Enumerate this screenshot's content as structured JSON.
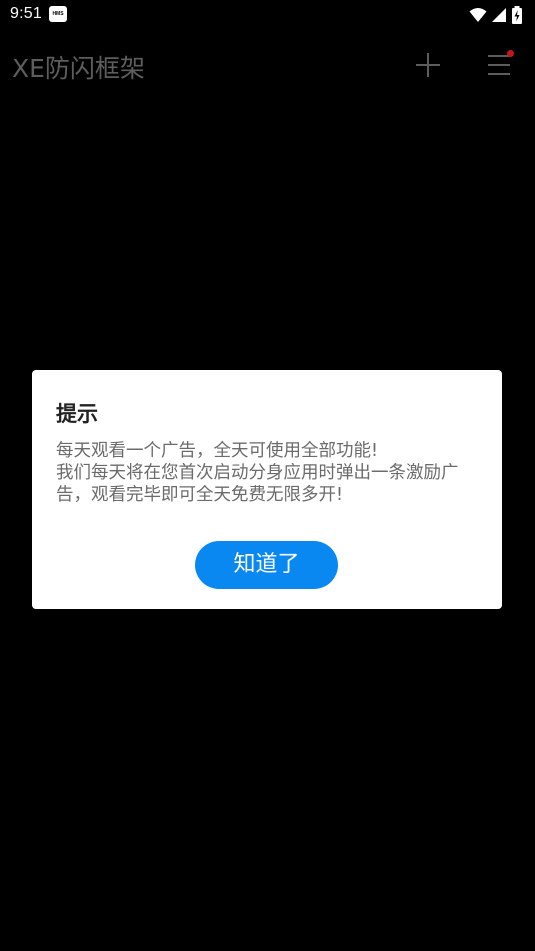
{
  "status_bar": {
    "time": "9:51",
    "hms_badge": "HMS",
    "icons": [
      "wifi-icon",
      "cellular-signal-icon",
      "battery-charging-icon"
    ]
  },
  "app_bar": {
    "title": "XE防闪框架",
    "add_icon": "plus-icon",
    "menu_icon": "hamburger-menu-icon",
    "has_notification_dot": true
  },
  "dialog": {
    "title": "提示",
    "message_line_1": "每天观看一个广告，全天可使用全部功能!",
    "message_line_2": "我们每天将在您首次启动分身应用时弹出一条激励广告，观看完毕即可全天免费无限多开!",
    "ok_label": "知道了"
  },
  "colors": {
    "background": "#000000",
    "title_text": "#5d5d5d",
    "primary_button": "#0a88f2",
    "notification_dot": "#c4181a",
    "dialog_background": "#ffffff"
  }
}
